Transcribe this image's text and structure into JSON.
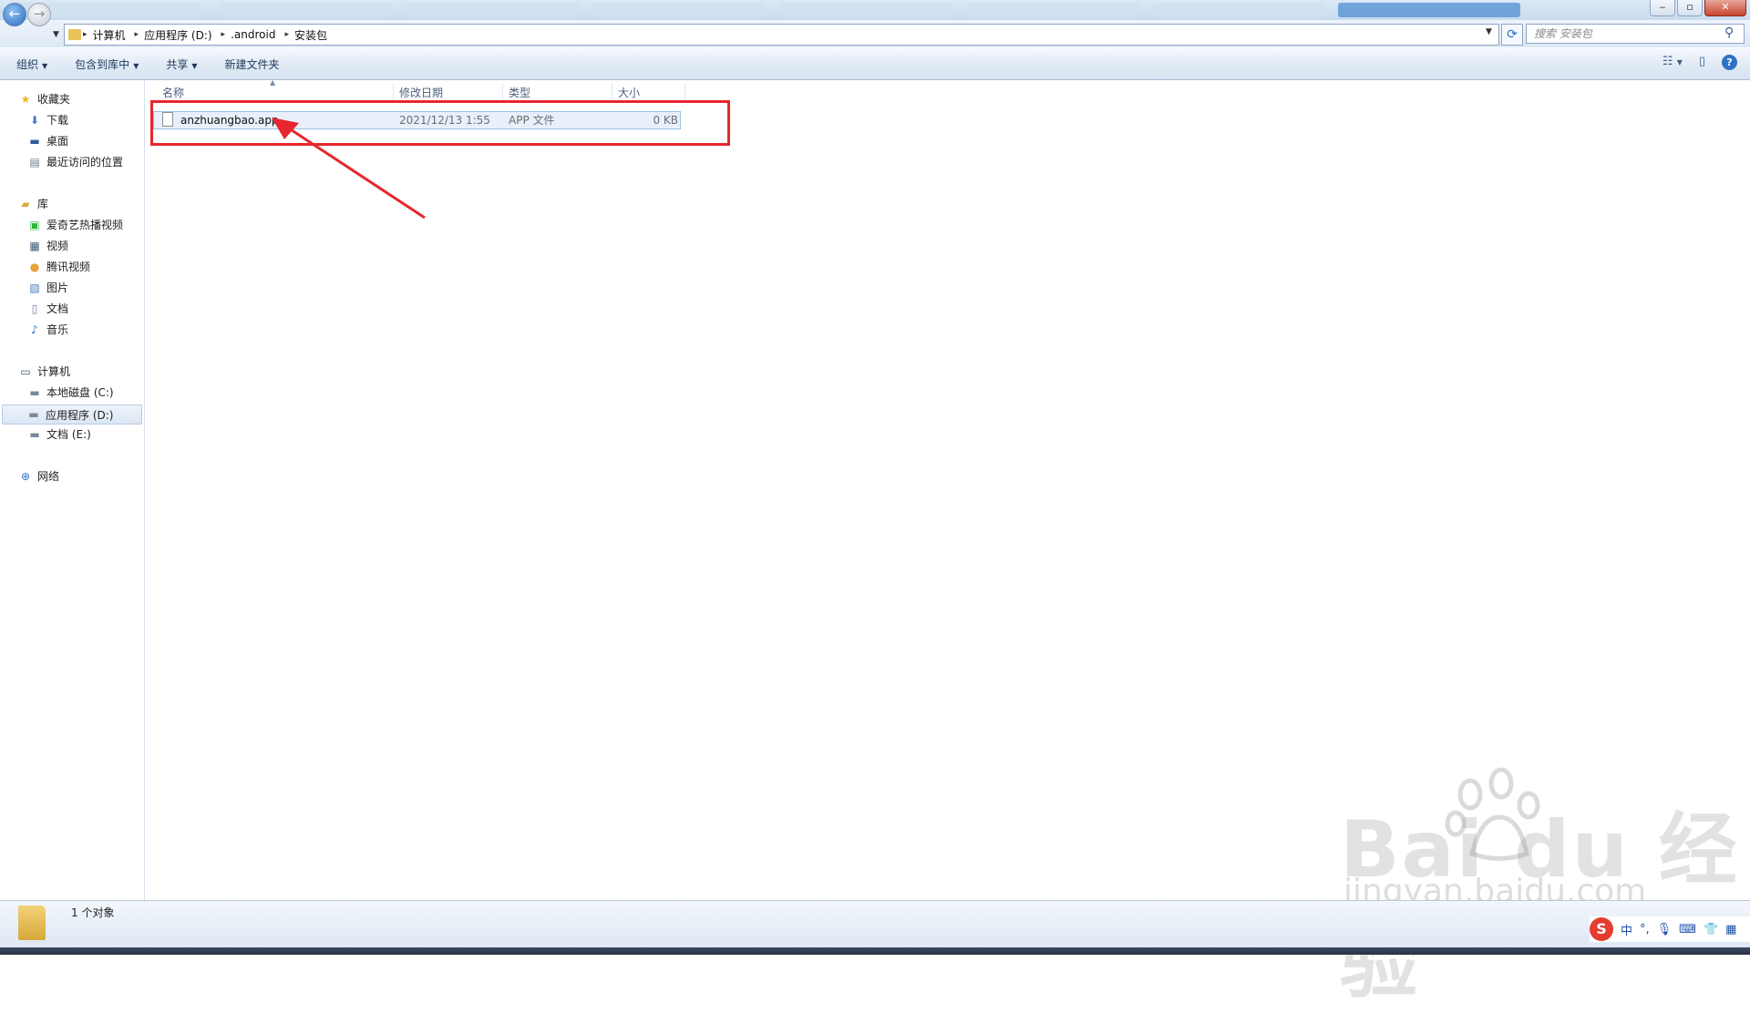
{
  "window": {
    "minimize_label": "‒",
    "maximize_label": "▫",
    "close_label": "✕"
  },
  "address": {
    "crumbs": [
      "计算机",
      "应用程序 (D:)",
      ".android",
      "安装包"
    ],
    "search_placeholder": "搜索 安装包"
  },
  "toolbar": {
    "organize": "组织",
    "include_in_library": "包含到库中",
    "share": "共享",
    "new_folder": "新建文件夹"
  },
  "sidebar": {
    "favorites": {
      "label": "收藏夹",
      "items": [
        "下载",
        "桌面",
        "最近访问的位置"
      ]
    },
    "libraries": {
      "label": "库",
      "items": [
        "爱奇艺热播视频",
        "视频",
        "腾讯视频",
        "图片",
        "文档",
        "音乐"
      ]
    },
    "computer": {
      "label": "计算机",
      "items": [
        "本地磁盘 (C:)",
        "应用程序 (D:)",
        "文档 (E:)"
      ]
    },
    "network": {
      "label": "网络"
    }
  },
  "columns": {
    "name": "名称",
    "modified": "修改日期",
    "type": "类型",
    "size": "大小"
  },
  "files": [
    {
      "name": "anzhuangbao.app",
      "modified": "2021/12/13 1:55",
      "type": "APP 文件",
      "size": "0 KB"
    }
  ],
  "status": {
    "count": "1 个对象"
  },
  "ime": {
    "lang": "中",
    "punct": "°,",
    "logo": "S"
  },
  "watermark": {
    "brand": "Bai du 经验",
    "url": "jingyan.baidu.com"
  },
  "colors": {
    "highlight": "#e8262d",
    "accent": "#2f73c7"
  }
}
